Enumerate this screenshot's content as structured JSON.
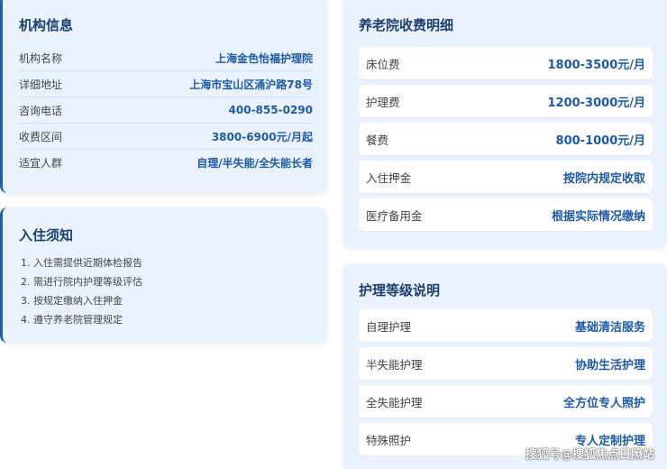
{
  "institution": {
    "title": "机构信息",
    "rows": [
      {
        "label": "机构名称",
        "value": "上海金色怡福护理院"
      },
      {
        "label": "详细地址",
        "value": "上海市宝山区涌沪路78号"
      },
      {
        "label": "咨询电话",
        "value": "400-855-0290"
      },
      {
        "label": "收费区间",
        "value": "3800-6900元/月起"
      },
      {
        "label": "适宜人群",
        "value": "自理/半失能/全失能长者"
      }
    ]
  },
  "notice": {
    "title": "入住须知",
    "items": [
      "1. 入住需提供近期体检报告",
      "2. 需进行院内护理等级评估",
      "3. 按规定缴纳入住押金",
      "4. 遵守养老院管理规定"
    ]
  },
  "fees": {
    "title": "养老院收费明细",
    "rows": [
      {
        "label": "床位费",
        "value": "1800-3500元/月"
      },
      {
        "label": "护理费",
        "value": "1200-3000元/月"
      },
      {
        "label": "餐费",
        "value": "800-1000元/月"
      },
      {
        "label": "入住押金",
        "value": "按院内规定收取"
      },
      {
        "label": "医疗备用金",
        "value": "根据实际情况缴纳"
      }
    ]
  },
  "care_levels": {
    "title": "护理等级说明",
    "rows": [
      {
        "label": "自理护理",
        "value": "基础清洁服务"
      },
      {
        "label": "半失能护理",
        "value": "协助生活护理"
      },
      {
        "label": "全失能护理",
        "value": "全方位专人照护"
      },
      {
        "label": "特殊照护",
        "value": "专人定制护理"
      }
    ]
  },
  "watermark": "搜狐号@搜狐焦点日照站",
  "colors": {
    "card_bg": "#eaf3fd",
    "accent": "#1f5fa6",
    "title": "#1a3f6f",
    "value": "#1e5aa8"
  }
}
